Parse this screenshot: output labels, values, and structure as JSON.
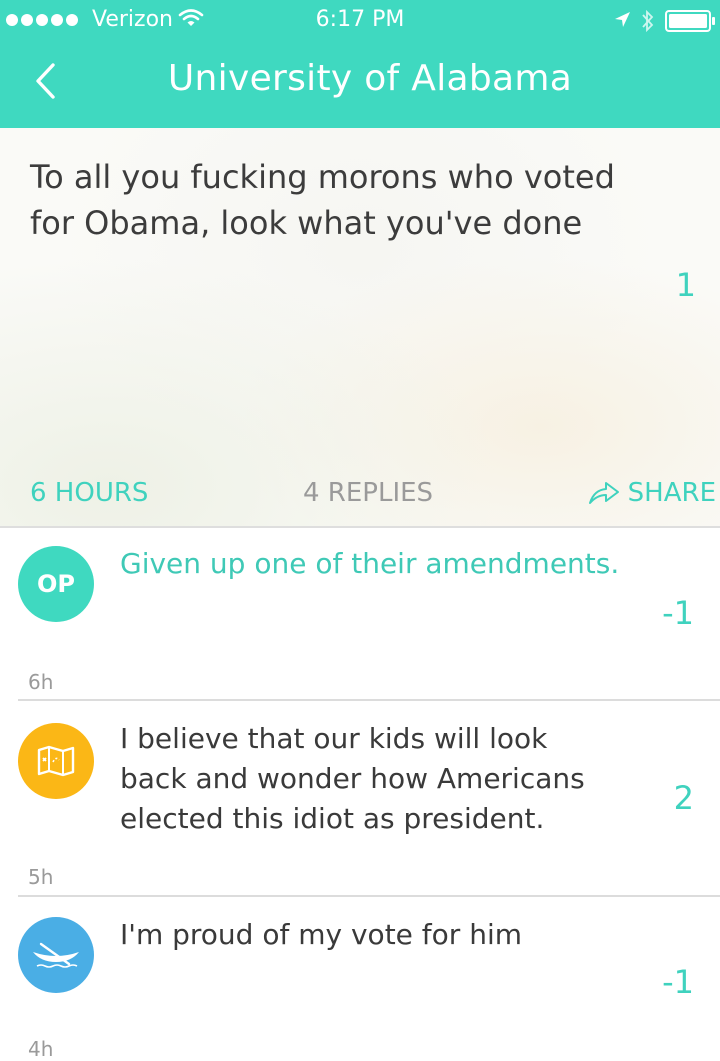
{
  "status_bar": {
    "carrier": "Verizon",
    "time": "6:17 PM"
  },
  "nav": {
    "title": "University of Alabama"
  },
  "post": {
    "text": "To all you fucking morons who voted for Obama, look what you've done",
    "votes": "1",
    "time": "6 HOURS",
    "replies": "4 REPLIES",
    "share_label": "SHARE"
  },
  "replies": [
    {
      "avatar_label": "OP",
      "avatar_icon": "op-badge",
      "text": "Given up one of their amendments.",
      "votes": "-1",
      "age": "6h"
    },
    {
      "avatar_icon": "map-icon",
      "text": "I believe that our kids will look back and wonder how Americans elected this idiot as president.",
      "votes": "2",
      "age": "5h"
    },
    {
      "avatar_icon": "canoe-icon",
      "text": "I'm proud of my vote for him",
      "votes": "-1",
      "age": "4h"
    }
  ],
  "colors": {
    "accent": "#3fd9c0",
    "orange": "#fbb716",
    "blue": "#4aaee5"
  }
}
